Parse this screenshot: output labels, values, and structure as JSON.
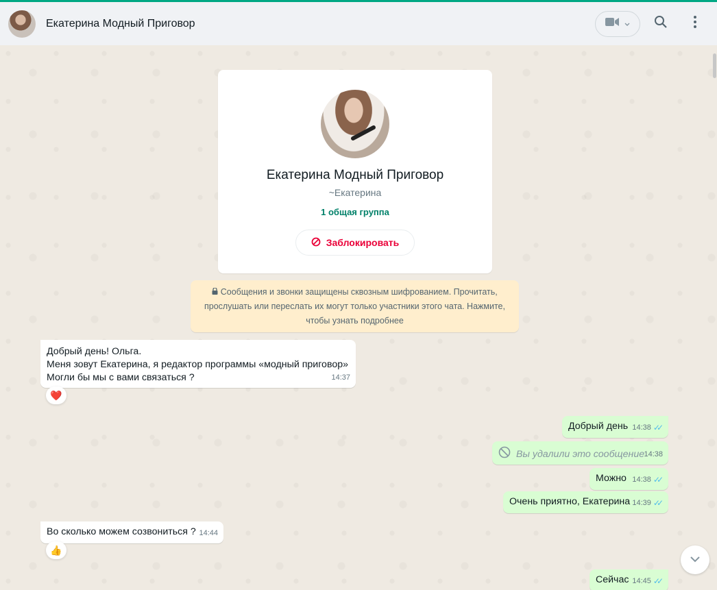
{
  "header": {
    "chat_title": "Екатерина Модный Приговор",
    "icons": [
      "avatar",
      "video-call-icon",
      "chevron-down-icon",
      "search-icon",
      "menu-icon"
    ]
  },
  "profile": {
    "name": "Екатерина Модный Приговор",
    "alias": "~Екатерина",
    "common_groups": "1 общая группа",
    "block_label": "Заблокировать"
  },
  "encryption_notice": "Сообщения и звонки защищены сквозным шифрованием. Прочитать, прослушать или переслать их могут только участники этого чата. Нажмите, чтобы узнать подробнее",
  "messages": [
    {
      "direction": "in",
      "lines": [
        "Добрый день! Ольга.",
        "Меня зовут Екатерина, я редактор программы «модный приговор»",
        "Могли бы мы с вами связаться ?"
      ],
      "time": "14:37",
      "reaction": "❤️"
    },
    {
      "direction": "out",
      "text": "Добрый день",
      "time": "14:38",
      "read": true
    },
    {
      "direction": "out",
      "text": "Вы удалили это сообщение",
      "time": "14:38",
      "deleted": true
    },
    {
      "direction": "out",
      "text": "Можно",
      "time": "14:38",
      "read": true
    },
    {
      "direction": "out",
      "text": "Очень приятно, Екатерина",
      "time": "14:39",
      "read": true
    },
    {
      "direction": "in",
      "text": "Во сколько можем созвониться ?",
      "time": "14:44",
      "reaction": "👍"
    },
    {
      "direction": "out",
      "text": "Сейчас",
      "time": "14:45",
      "read": true
    }
  ],
  "colors": {
    "accent": "#00a884",
    "outgoing_bubble": "#d9fdd3",
    "incoming_bubble": "#ffffff",
    "block_red": "#ea0038",
    "notice_bg": "#ffeecd",
    "read_check": "#53bdeb"
  }
}
